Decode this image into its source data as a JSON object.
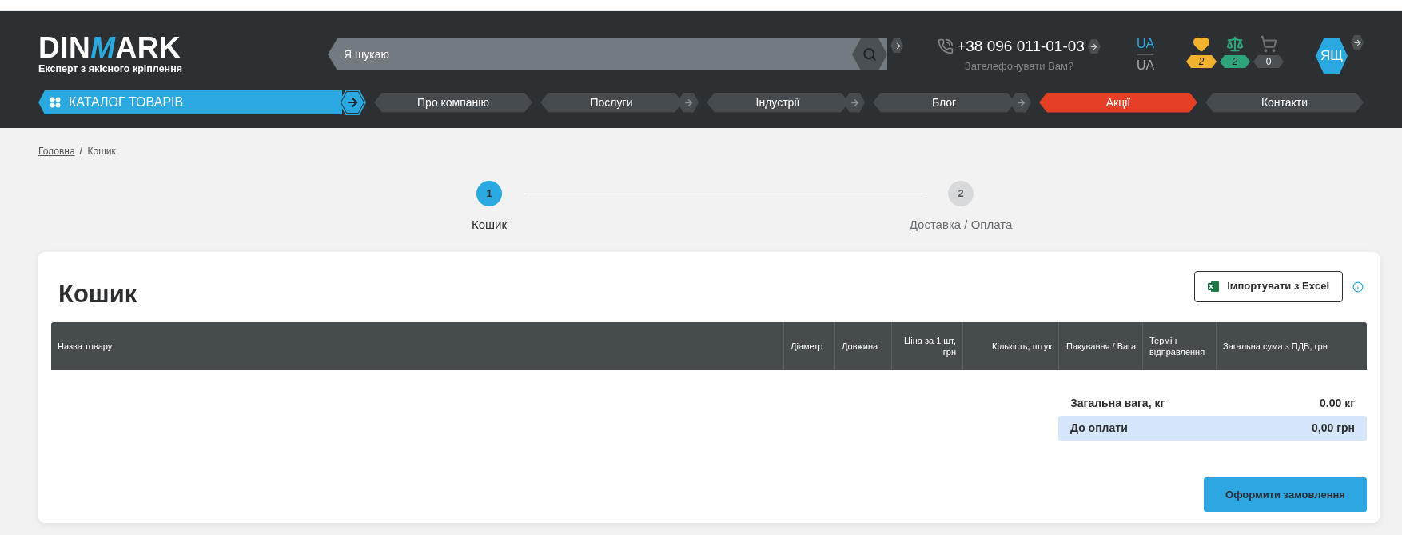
{
  "logo": {
    "wordmark_start": "DIN",
    "wordmark_mark": "M",
    "wordmark_end": "ARK",
    "tagline": "Експерт з якісного кріплення"
  },
  "search": {
    "placeholder": "Я шукаю"
  },
  "phone": {
    "number": "+38 096 011-01-03",
    "callback": "Зателефонувати Вам?"
  },
  "languages": [
    {
      "label": "UA",
      "selected": true
    },
    {
      "label": "UA",
      "selected": false
    }
  ],
  "counters": [
    {
      "kind": "favorites",
      "count": "2",
      "color": "#f3b22d"
    },
    {
      "kind": "compare",
      "count": "2",
      "color": "#2fa37a"
    },
    {
      "kind": "cart",
      "count": "0",
      "color": "#4b5054"
    }
  ],
  "user": {
    "initials": "ЯЩ"
  },
  "catalog": {
    "label": "КАТАЛОГ ТОВАРІВ"
  },
  "nav": [
    {
      "label": "Про компанію",
      "highlight": false,
      "submenu": false
    },
    {
      "label": "Послуги",
      "highlight": false,
      "submenu": true
    },
    {
      "label": "Індустрії",
      "highlight": false,
      "submenu": true
    },
    {
      "label": "Блог",
      "highlight": false,
      "submenu": true
    },
    {
      "label": "Акції",
      "highlight": true,
      "submenu": false
    },
    {
      "label": "Контакти",
      "highlight": false,
      "submenu": false
    }
  ],
  "breadcrumb": {
    "items": [
      {
        "label": "Головна",
        "link": true
      },
      {
        "label": "Кошик",
        "link": false
      }
    ],
    "separator": "/"
  },
  "steps": [
    {
      "number": "1",
      "label": "Кошик",
      "selected": true
    },
    {
      "number": "2",
      "label": "Доставка / Оплата",
      "selected": false
    }
  ],
  "cart": {
    "title": "Кошик",
    "import_button": "Імпортувати з Excel",
    "columns": [
      "Назва товару",
      "Діаметр",
      "Довжина",
      "Ціна за 1 шт, грн",
      "Кількість, штук",
      "Пакування / Вага",
      "Термін відправлення",
      "Загальна сума з ПДВ, грн"
    ],
    "totals": [
      {
        "label": "Загальна вага, кг",
        "value": "0.00 кг",
        "highlight": false
      },
      {
        "label": "До оплати",
        "value": "0,00 грн",
        "highlight": true
      }
    ],
    "checkout_button": "Оформити замовлення"
  }
}
